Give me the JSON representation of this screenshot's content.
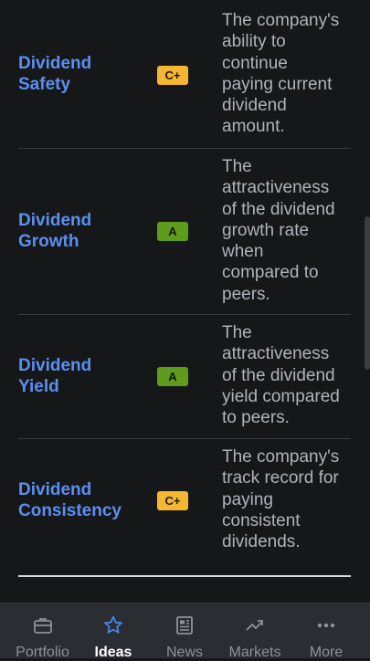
{
  "ratings": [
    {
      "label_line1": "Dividend",
      "label_line2": "Safety",
      "grade": "C+",
      "desc_lines": [
        "The company's",
        "ability to",
        "continue",
        "paying current",
        "dividend",
        "amount."
      ]
    },
    {
      "label_line1": "Dividend",
      "label_line2": "Growth",
      "grade": "A",
      "desc_lines": [
        "The",
        "attractiveness",
        "of the dividend",
        "growth rate",
        "when",
        "compared to",
        "peers."
      ]
    },
    {
      "label_line1": "Dividend",
      "label_line2": "Yield",
      "grade": "A",
      "desc_lines": [
        "The",
        "attractiveness",
        "of the dividend",
        "yield compared",
        "to peers."
      ]
    },
    {
      "label_line1": "Dividend",
      "label_line2": "Consistency",
      "grade": "C+",
      "desc_lines": [
        "The company's",
        "track record for",
        "paying",
        "consistent",
        "dividends."
      ]
    }
  ],
  "tabs": [
    {
      "label": "Portfolio",
      "icon": "briefcase-icon"
    },
    {
      "label": "Ideas",
      "icon": "star-icon",
      "active": true
    },
    {
      "label": "News",
      "icon": "newspaper-icon"
    },
    {
      "label": "Markets",
      "icon": "trending-up-icon"
    },
    {
      "label": "More",
      "icon": "more-dots-icon"
    }
  ],
  "colors": {
    "background": "#151719",
    "link": "#5b8ff0",
    "grade_c_plus": "#f5b731",
    "grade_a": "#5f9b1c",
    "tabbar": "#2a2d31",
    "active_tab": "#4a86f0"
  }
}
